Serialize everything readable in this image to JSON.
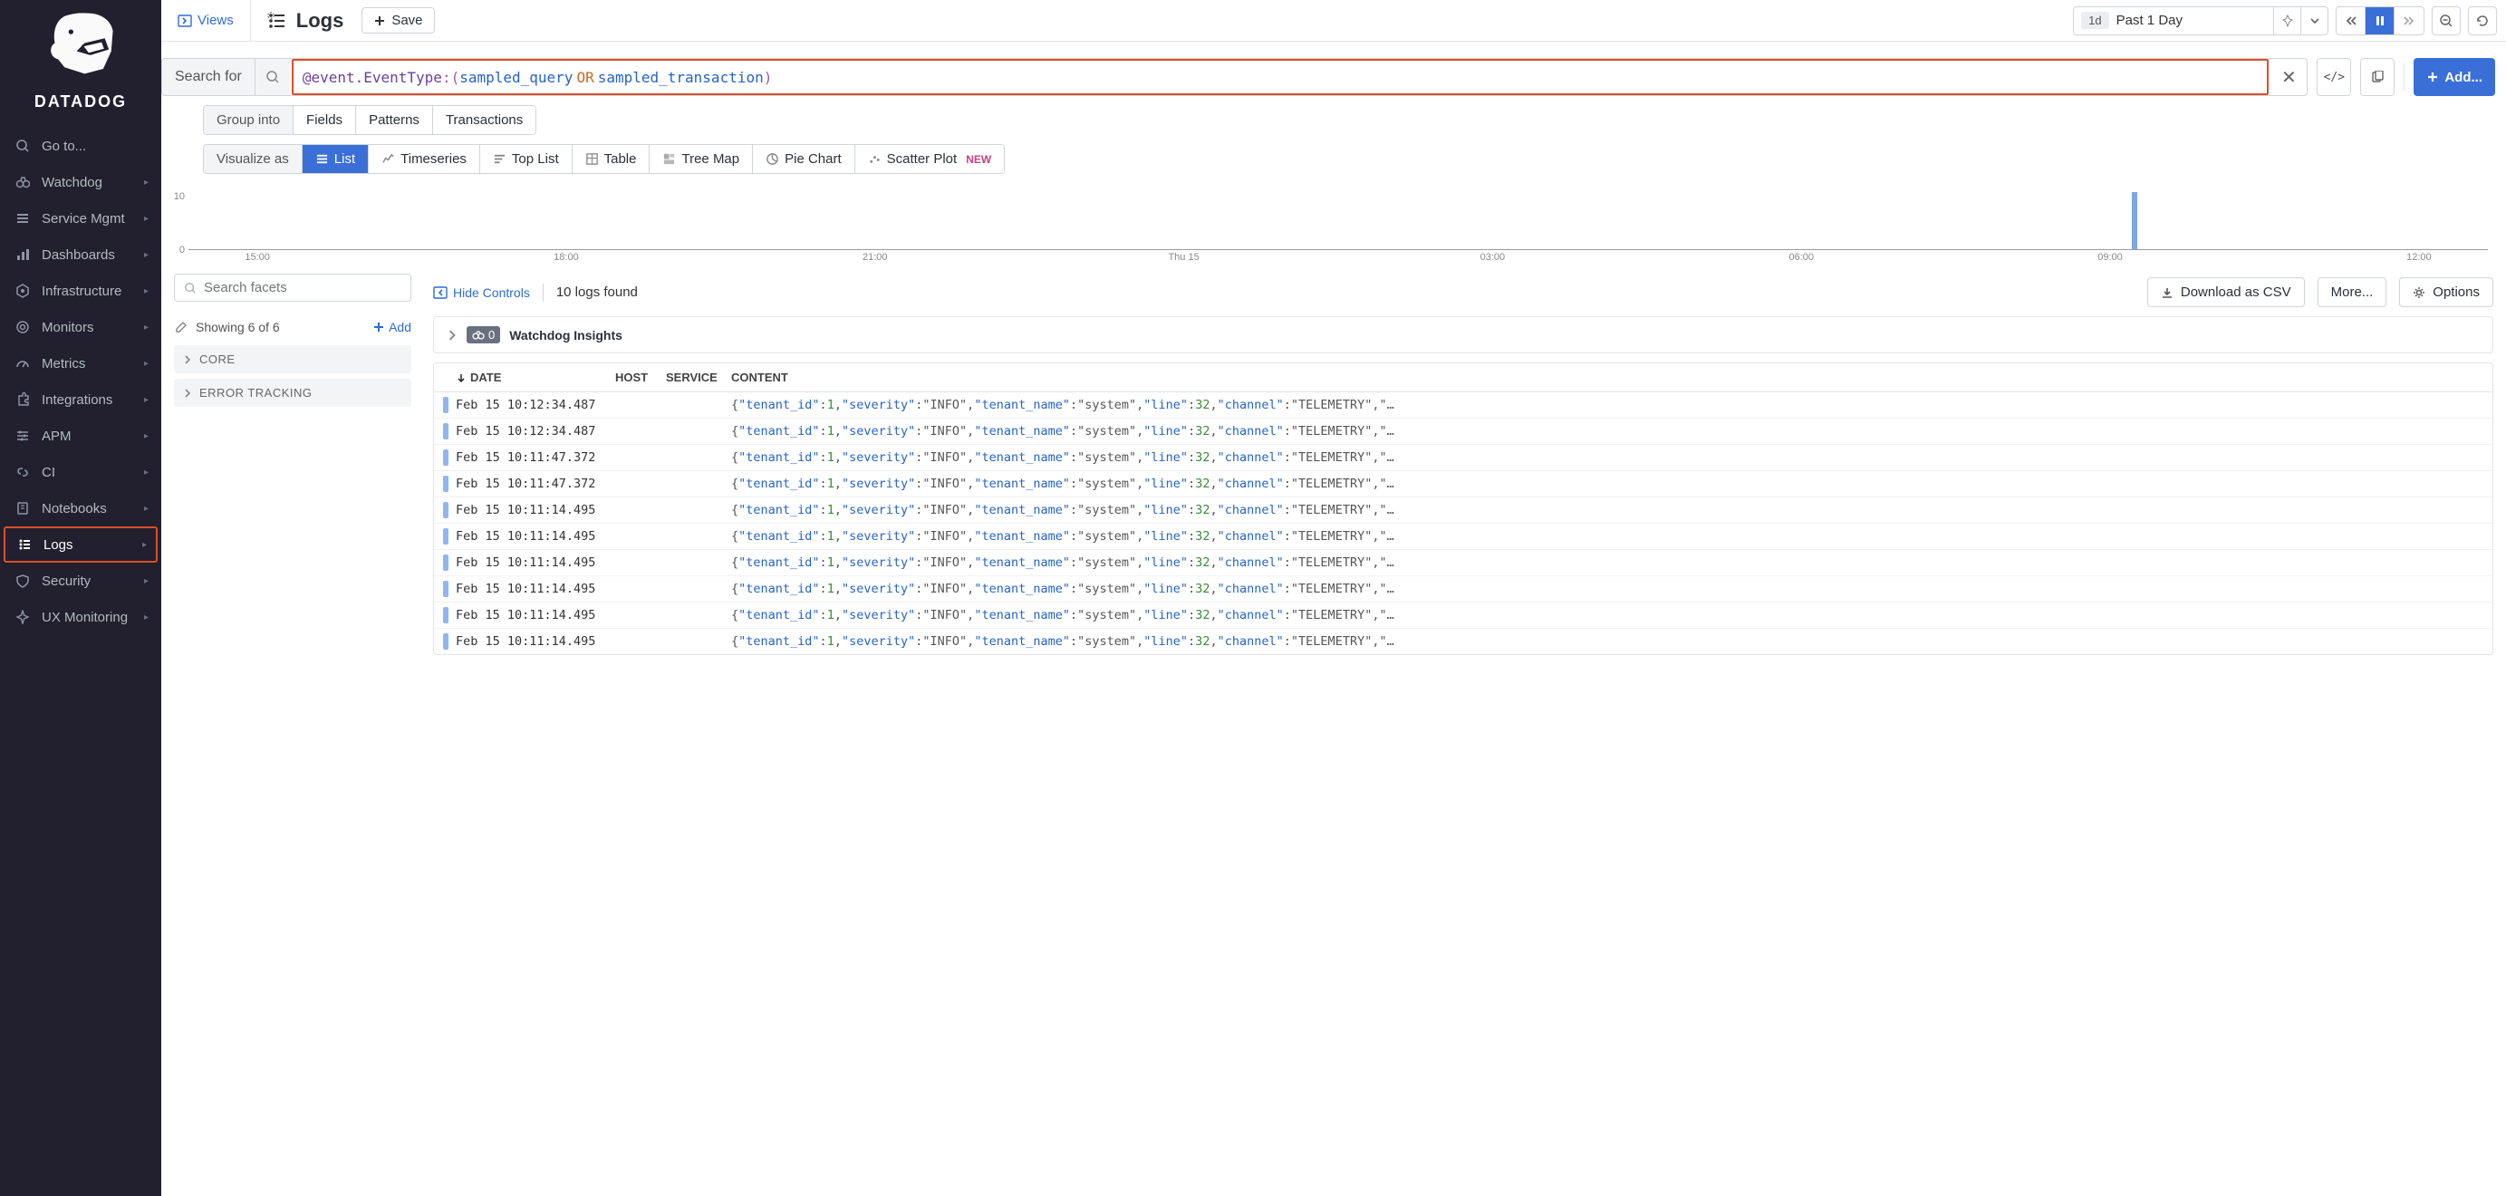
{
  "brand": {
    "name": "DATADOG"
  },
  "sidebar": {
    "items": [
      {
        "label": "Go to...",
        "icon": "search"
      },
      {
        "label": "Watchdog",
        "icon": "binoculars",
        "caret": true
      },
      {
        "label": "Service Mgmt",
        "icon": "list",
        "caret": true
      },
      {
        "label": "Dashboards",
        "icon": "chart",
        "caret": true
      },
      {
        "label": "Infrastructure",
        "icon": "hex",
        "caret": true
      },
      {
        "label": "Monitors",
        "icon": "target",
        "caret": true
      },
      {
        "label": "Metrics",
        "icon": "gauge",
        "caret": true
      },
      {
        "label": "Integrations",
        "icon": "puzzle",
        "caret": true
      },
      {
        "label": "APM",
        "icon": "lines",
        "caret": true
      },
      {
        "label": "CI",
        "icon": "link",
        "caret": true
      },
      {
        "label": "Notebooks",
        "icon": "book",
        "caret": true
      },
      {
        "label": "Logs",
        "icon": "logs",
        "caret": true,
        "active": true
      },
      {
        "label": "Security",
        "icon": "shield",
        "caret": true
      },
      {
        "label": "UX Monitoring",
        "icon": "spark",
        "caret": true
      }
    ]
  },
  "topbar": {
    "views": "Views",
    "title": "Logs",
    "save": "Save",
    "time_tag": "1d",
    "time_text": "Past 1 Day"
  },
  "search": {
    "label": "Search for",
    "query_attr": "@event.EventType",
    "query_punct1": ":(",
    "query_v1": "sampled_query",
    "query_op": "OR",
    "query_v2": "sampled_transaction",
    "query_punct2": ")",
    "add": "Add..."
  },
  "group": {
    "label": "Group into",
    "opts": [
      "Fields",
      "Patterns",
      "Transactions"
    ]
  },
  "visualize": {
    "label": "Visualize as",
    "opts": [
      {
        "label": "List",
        "active": true
      },
      {
        "label": "Timeseries"
      },
      {
        "label": "Top List"
      },
      {
        "label": "Table"
      },
      {
        "label": "Tree Map"
      },
      {
        "label": "Pie Chart"
      },
      {
        "label": "Scatter Plot",
        "badge": "NEW"
      }
    ]
  },
  "facets": {
    "placeholder": "Search facets",
    "showing": "Showing 6 of 6",
    "add": "Add",
    "cats": [
      "CORE",
      "ERROR TRACKING"
    ]
  },
  "midbar": {
    "hide": "Hide Controls",
    "found": "10 logs found",
    "download": "Download as CSV",
    "more": "More...",
    "options": "Options"
  },
  "insights": {
    "count": "0",
    "title": "Watchdog Insights"
  },
  "table": {
    "cols": {
      "date": "DATE",
      "host": "HOST",
      "service": "SERVICE",
      "content": "CONTENT"
    },
    "rows": [
      {
        "date": "Feb 15 10:12:34.487"
      },
      {
        "date": "Feb 15 10:12:34.487"
      },
      {
        "date": "Feb 15 10:11:47.372"
      },
      {
        "date": "Feb 15 10:11:47.372"
      },
      {
        "date": "Feb 15 10:11:14.495"
      },
      {
        "date": "Feb 15 10:11:14.495"
      },
      {
        "date": "Feb 15 10:11:14.495"
      },
      {
        "date": "Feb 15 10:11:14.495"
      },
      {
        "date": "Feb 15 10:11:14.495"
      },
      {
        "date": "Feb 15 10:11:14.495"
      }
    ],
    "content_sample": {
      "tenant_id": 1,
      "severity": "INFO",
      "tenant_name": "system",
      "line": 32,
      "channel": "TELEMETRY"
    }
  },
  "chart_data": {
    "type": "bar",
    "ylim": [
      0,
      10
    ],
    "yticks": [
      10,
      0
    ],
    "xticks": [
      "15:00",
      "18:00",
      "21:00",
      "Thu 15",
      "03:00",
      "06:00",
      "09:00",
      "12:00"
    ],
    "bars": [
      {
        "x_pct": 84.5,
        "value": 10
      }
    ]
  }
}
